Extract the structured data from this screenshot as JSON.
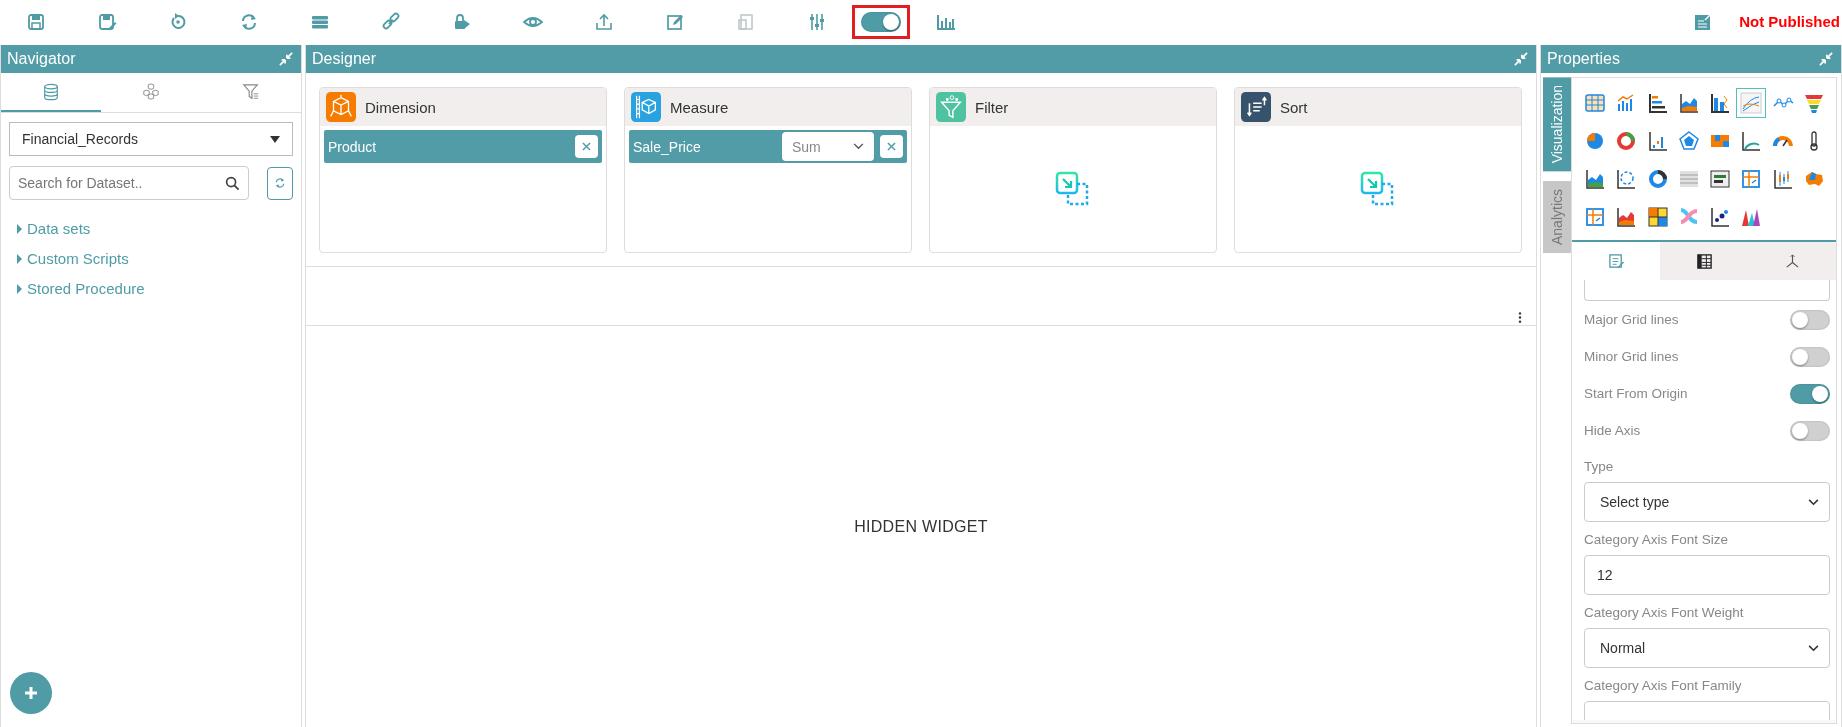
{
  "toolbar": {
    "preview_toggle": {
      "on": true,
      "highlighted": true
    },
    "status": "Not Published"
  },
  "navigator": {
    "title": "Navigator",
    "tabs": [
      {
        "kind": "database",
        "selected": true
      },
      {
        "kind": "cubes",
        "selected": false
      },
      {
        "kind": "filter",
        "selected": false
      }
    ],
    "dataset_select": {
      "value": "Financial_Records"
    },
    "search": {
      "placeholder": "Search for Dataset.."
    },
    "tree": [
      {
        "label": "Data sets",
        "expanded": false
      },
      {
        "label": "Custom Scripts",
        "expanded": false
      },
      {
        "label": "Stored Procedure",
        "expanded": false
      }
    ]
  },
  "designer": {
    "title": "Designer",
    "cards": [
      {
        "kind": "dimension",
        "title": "Dimension",
        "fields": [
          {
            "name": "Product"
          }
        ]
      },
      {
        "kind": "measure",
        "title": "Measure",
        "fields": [
          {
            "name": "Sale_Price",
            "aggregate": "Sum"
          }
        ]
      },
      {
        "kind": "filter",
        "title": "Filter"
      },
      {
        "kind": "sort",
        "title": "Sort"
      }
    ],
    "widget_text": "HIDDEN WIDGET"
  },
  "properties": {
    "title": "Properties",
    "side_tabs": [
      {
        "label": "Visualization",
        "selected": true
      },
      {
        "label": "Analytics",
        "selected": false
      }
    ],
    "chart_types": [
      {
        "kind": "table",
        "selected": false
      },
      {
        "kind": "combo",
        "selected": false
      },
      {
        "kind": "hbar",
        "selected": false
      },
      {
        "kind": "area",
        "selected": false
      },
      {
        "kind": "stacked",
        "selected": false
      },
      {
        "kind": "lines",
        "selected": true
      },
      {
        "kind": "dotline",
        "selected": false
      },
      {
        "kind": "funnel",
        "selected": false
      },
      {
        "kind": "pie",
        "selected": false
      },
      {
        "kind": "donut",
        "selected": false
      },
      {
        "kind": "step",
        "selected": false
      },
      {
        "kind": "radar",
        "selected": false
      },
      {
        "kind": "heat",
        "selected": false
      },
      {
        "kind": "arc",
        "selected": false
      },
      {
        "kind": "gauge",
        "selected": false
      },
      {
        "kind": "thermo",
        "selected": false
      },
      {
        "kind": "arealine",
        "selected": false
      },
      {
        "kind": "polar",
        "selected": false
      },
      {
        "kind": "ring",
        "selected": false
      },
      {
        "kind": "grid",
        "selected": false
      },
      {
        "kind": "pivot",
        "selected": false
      },
      {
        "kind": "tile",
        "selected": false
      },
      {
        "kind": "candle",
        "selected": false
      },
      {
        "kind": "map",
        "selected": false
      },
      {
        "kind": "tile",
        "selected": false
      },
      {
        "kind": "stackarea",
        "selected": false
      },
      {
        "kind": "treemap",
        "selected": false
      },
      {
        "kind": "sankey",
        "selected": false
      },
      {
        "kind": "scatter",
        "selected": false
      },
      {
        "kind": "spikes",
        "selected": false
      }
    ],
    "tabs": [
      {
        "kind": "format",
        "selected": true
      },
      {
        "kind": "columns",
        "selected": false
      },
      {
        "kind": "axes",
        "selected": false
      }
    ],
    "settings": [
      {
        "kind": "toggle",
        "label": "Major Grid lines",
        "on": false
      },
      {
        "kind": "toggle",
        "label": "Minor Grid lines",
        "on": false
      },
      {
        "kind": "toggle",
        "label": "Start From Origin",
        "on": true
      },
      {
        "kind": "toggle",
        "label": "Hide Axis",
        "on": false
      },
      {
        "kind": "select",
        "label": "Type",
        "value": "Select type"
      },
      {
        "kind": "input",
        "label": "Category Axis Font Size",
        "value": "12"
      },
      {
        "kind": "select",
        "label": "Category Axis Font Weight",
        "value": "Normal"
      },
      {
        "kind": "input",
        "label": "Category Axis Font Family"
      }
    ]
  }
}
